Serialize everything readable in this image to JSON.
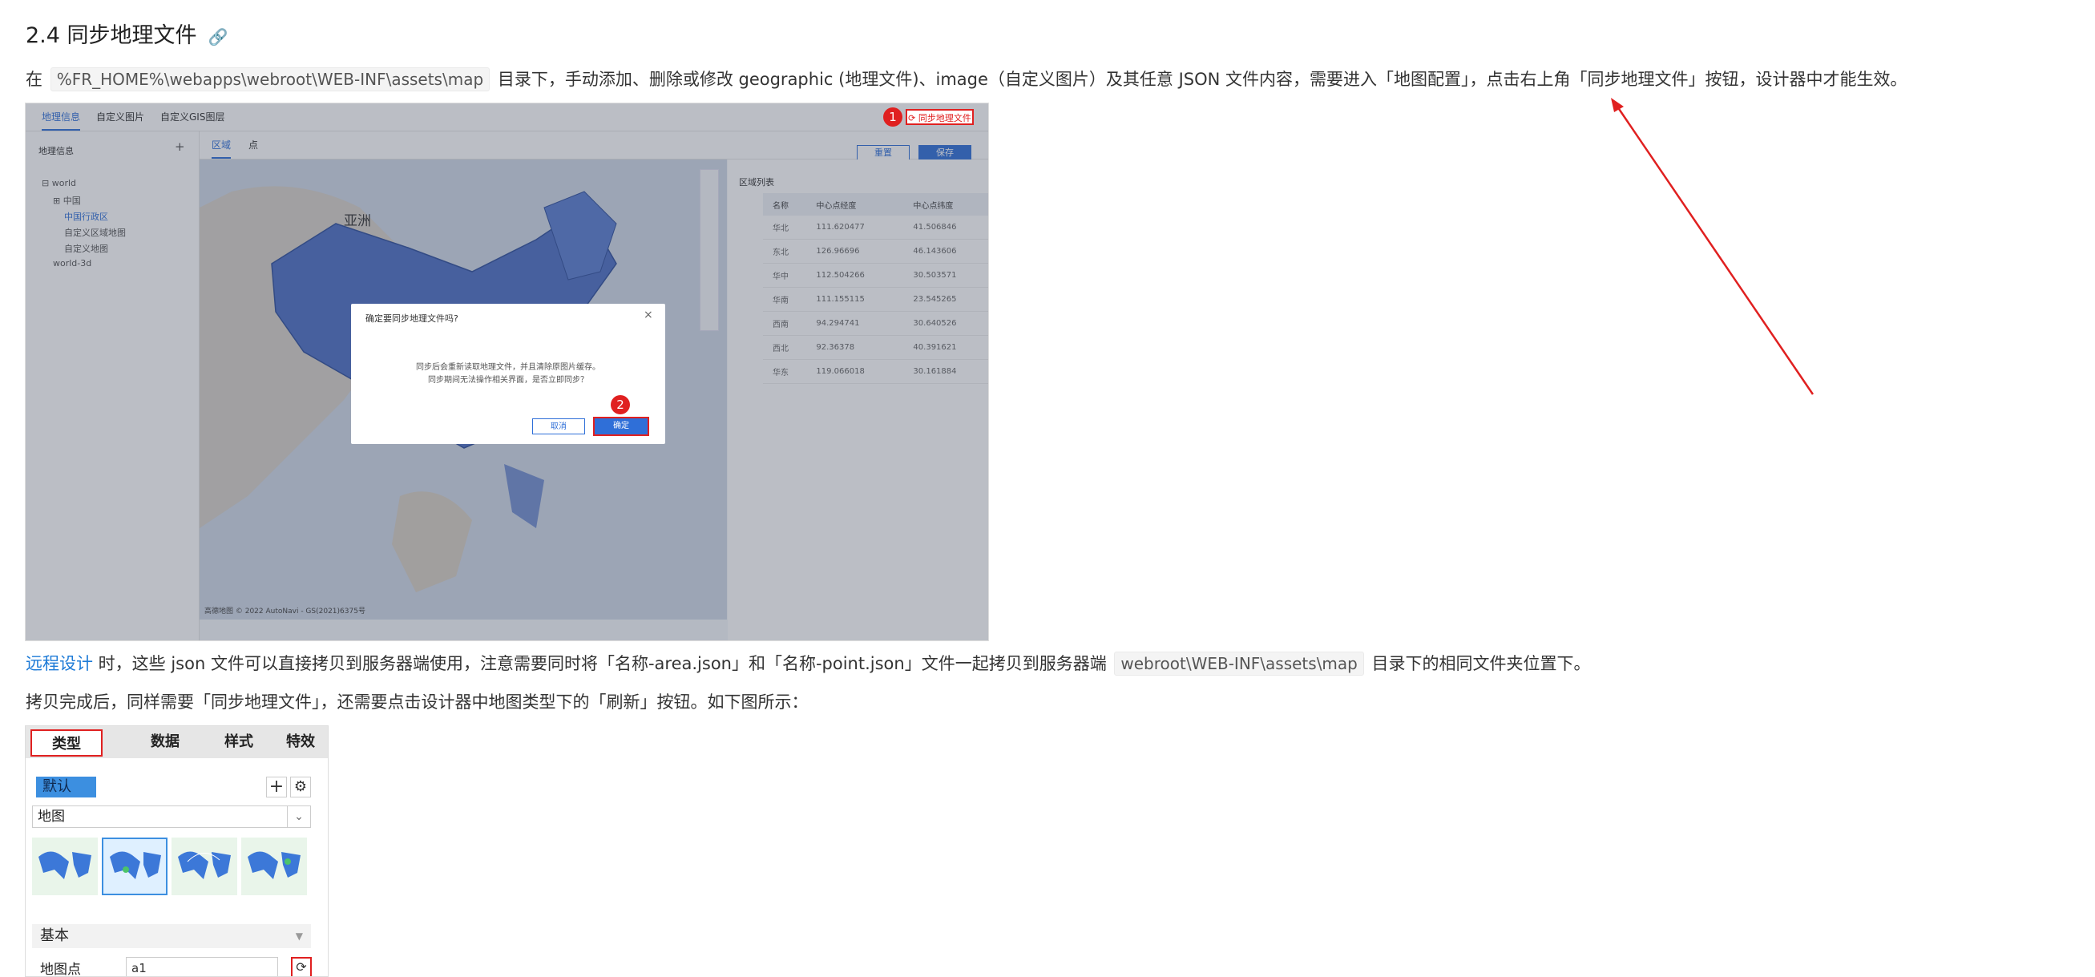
{
  "heading": {
    "text": "2.4 同步地理文件",
    "anchor_icon": "link-icon"
  },
  "para1": {
    "prefix": "在 ",
    "code": "%FR_HOME%\\webapps\\webroot\\WEB-INF\\assets\\map",
    "suffix": " 目录下，手动添加、删除或修改 geographic (地理文件)、image（自定义图片）及其任意 JSON 文件内容，需要进入「地图配置」，点击右上角「同步地理文件」按钮，设计器中才能生效。"
  },
  "shot1": {
    "top_tabs": [
      "地理信息",
      "自定义图片",
      "自定义GIS图层"
    ],
    "sync_button": "同步地理文件",
    "left_panel_title": "地理信息",
    "add_icon": "+",
    "tree": [
      "world",
      "中国",
      "中国行政区",
      "自定义区域地图",
      "自定义地图",
      "world-3d"
    ],
    "sub_tabs": [
      "区域",
      "点"
    ],
    "reset_label": "重置",
    "save_label": "保存",
    "map_label": "亚洲",
    "map_credit": "高德地图 © 2022 AutoNavi - GS(2021)6375号",
    "region_list_title": "区域列表",
    "table_headers": [
      "名称",
      "中心点经度",
      "中心点纬度"
    ],
    "table_rows": [
      [
        "华北",
        "111.620477",
        "41.506846"
      ],
      [
        "东北",
        "126.96696",
        "46.143606"
      ],
      [
        "华中",
        "112.504266",
        "30.503571"
      ],
      [
        "华南",
        "111.155115",
        "23.545265"
      ],
      [
        "西南",
        "94.294741",
        "30.640526"
      ],
      [
        "西北",
        "92.36378",
        "40.391621"
      ],
      [
        "华东",
        "119.066018",
        "30.161884"
      ]
    ],
    "dialog": {
      "title": "确定要同步地理文件吗?",
      "close": "×",
      "body_line1": "同步后会重新读取地理文件，并且清除原图片缓存。",
      "body_line2": "同步期间无法操作相关界面，是否立即同步？",
      "cancel": "取消",
      "ok": "确定"
    },
    "badge1": "1",
    "badge2": "2"
  },
  "para2": {
    "link": "远程设计",
    "text_a": " 时，这些 json 文件可以直接拷贝到服务器端使用，注意需要同时将「名称-area.json」和「名称-point.json」文件一起拷贝到服务器端 ",
    "code": "webroot\\WEB-INF\\assets\\map",
    "text_b": " 目录下的相同文件夹位置下。"
  },
  "para3": {
    "text": "拷贝完成后，同样需要「同步地理文件」，还需要点击设计器中地图类型下的「刷新」按钮。如下图所示："
  },
  "shot2": {
    "tabs": [
      "类型",
      "数据",
      "样式",
      "特效"
    ],
    "default_label": "默认",
    "add_icon": "+",
    "settings_icon": "gear-icon",
    "select_value": "地图",
    "section_label": "基本",
    "row_label": "地图点",
    "row_value": "a1",
    "refresh_icon": "refresh-icon"
  },
  "colors": {
    "accent_blue": "#2f6fd8",
    "annotation_red": "#e02020",
    "link_blue": "#1e7bd7"
  }
}
